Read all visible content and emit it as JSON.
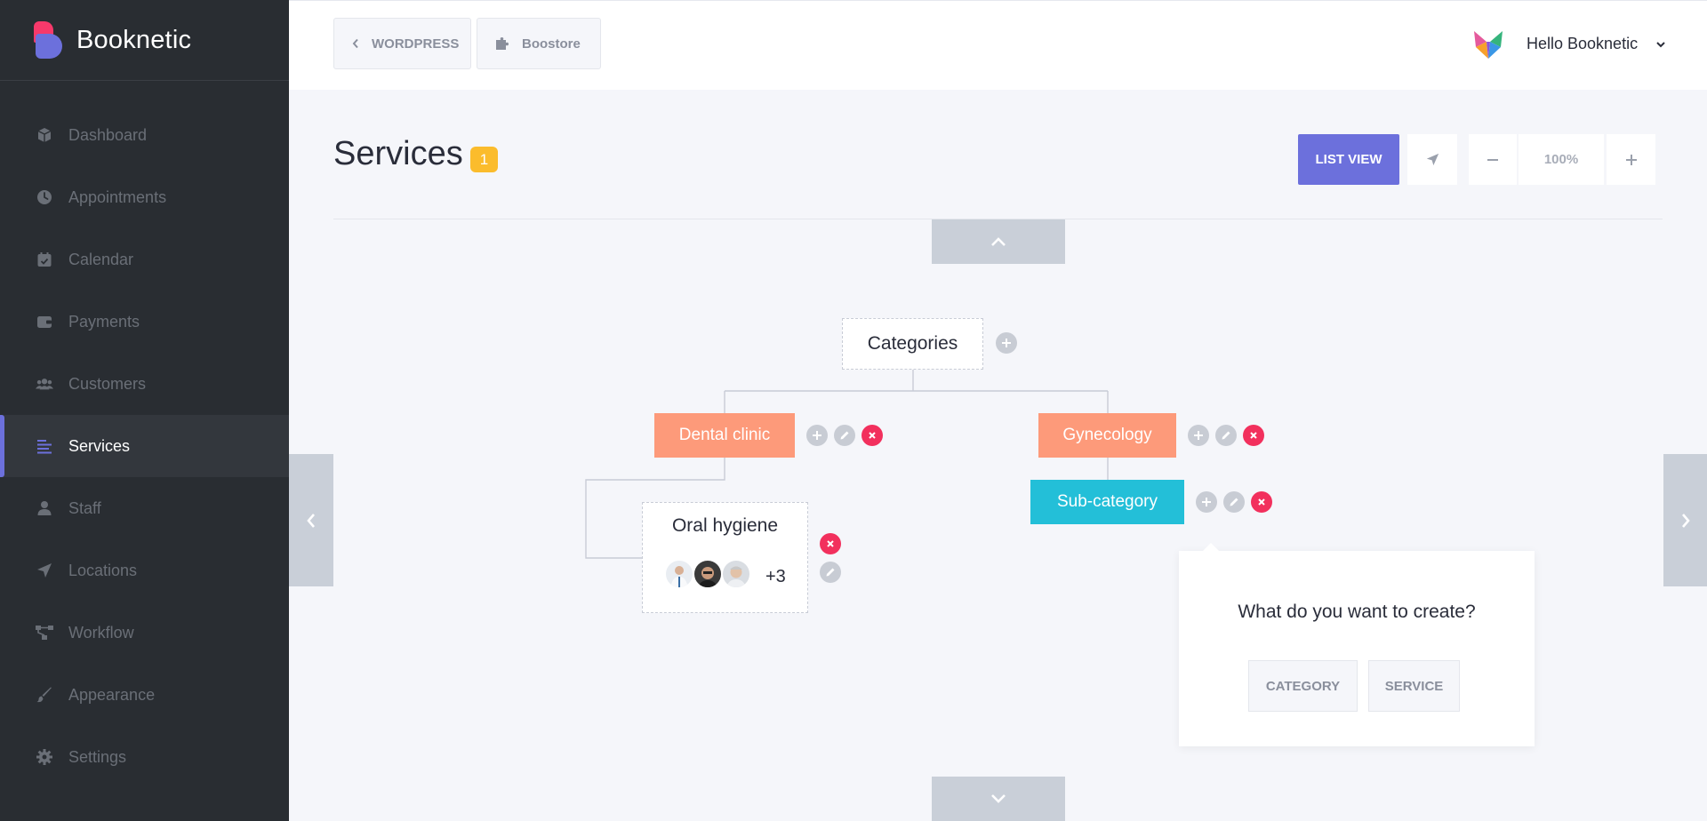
{
  "brand": {
    "name": "Booknetic"
  },
  "sidebar": {
    "items": [
      {
        "label": "Dashboard",
        "icon": "cube-icon"
      },
      {
        "label": "Appointments",
        "icon": "clock-icon"
      },
      {
        "label": "Calendar",
        "icon": "calendar-icon"
      },
      {
        "label": "Payments",
        "icon": "wallet-icon"
      },
      {
        "label": "Customers",
        "icon": "users-icon"
      },
      {
        "label": "Services",
        "icon": "list-icon",
        "active": true
      },
      {
        "label": "Staff",
        "icon": "user-icon"
      },
      {
        "label": "Locations",
        "icon": "location-arrow-icon"
      },
      {
        "label": "Workflow",
        "icon": "workflow-icon"
      },
      {
        "label": "Appearance",
        "icon": "brush-icon"
      },
      {
        "label": "Settings",
        "icon": "gear-icon"
      }
    ]
  },
  "header": {
    "crumbs": [
      {
        "label": "WORDPRESS"
      },
      {
        "label": "Boostore"
      }
    ],
    "greeting": "Hello Booknetic"
  },
  "page": {
    "title": "Services",
    "count": "1",
    "list_view_label": "LIST VIEW",
    "zoom_level": "100%"
  },
  "tree": {
    "root": "Categories",
    "categories": [
      {
        "label": "Dental clinic"
      },
      {
        "label": "Gynecology"
      }
    ],
    "subcategory": "Sub-category",
    "service": {
      "label": "Oral hygiene",
      "extra_staff": "+3"
    }
  },
  "popup": {
    "question": "What do you want to create?",
    "category_label": "CATEGORY",
    "service_label": "SERVICE"
  },
  "colors": {
    "sidebar_bg": "#292d32",
    "accent": "#6c70dc",
    "category": "#fd9a7a",
    "subcategory": "#23bfd8",
    "danger": "#f2305d",
    "badge": "#fbbc2c"
  }
}
